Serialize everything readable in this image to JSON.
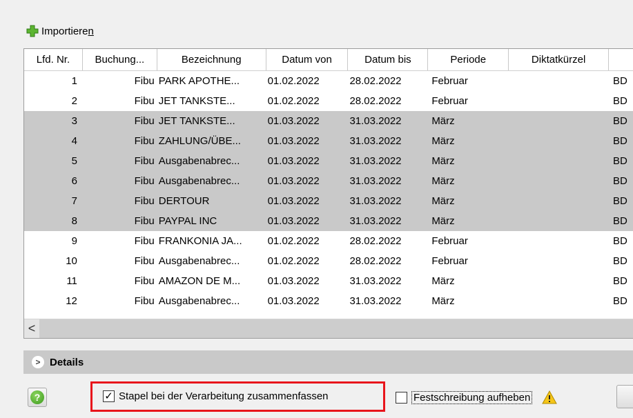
{
  "toolbar": {
    "import_label_main": "Importiere",
    "import_label_accel": "n"
  },
  "table": {
    "headers": [
      "Lfd. Nr.",
      "Buchung...",
      "Bezeichnung",
      "Datum von",
      "Datum bis",
      "Periode",
      "Diktatkürzel",
      ""
    ],
    "rows": [
      {
        "nr": "1",
        "buchung": "Fibu",
        "bez": "PARK APOTHE...",
        "von": "01.02.2022",
        "bis": "28.02.2022",
        "periode": "Februar",
        "diktat": "",
        "extra": "BD",
        "selected": false
      },
      {
        "nr": "2",
        "buchung": "Fibu",
        "bez": "JET TANKSTE...",
        "von": "01.02.2022",
        "bis": "28.02.2022",
        "periode": "Februar",
        "diktat": "",
        "extra": "BD",
        "selected": false
      },
      {
        "nr": "3",
        "buchung": "Fibu",
        "bez": "JET TANKSTE...",
        "von": "01.03.2022",
        "bis": "31.03.2022",
        "periode": "März",
        "diktat": "",
        "extra": "BD",
        "selected": true
      },
      {
        "nr": "4",
        "buchung": "Fibu",
        "bez": "ZAHLUNG/ÜBE...",
        "von": "01.03.2022",
        "bis": "31.03.2022",
        "periode": "März",
        "diktat": "",
        "extra": "BD",
        "selected": true
      },
      {
        "nr": "5",
        "buchung": "Fibu",
        "bez": "Ausgabenabrec...",
        "von": "01.03.2022",
        "bis": "31.03.2022",
        "periode": "März",
        "diktat": "",
        "extra": "BD",
        "selected": true
      },
      {
        "nr": "6",
        "buchung": "Fibu",
        "bez": "Ausgabenabrec...",
        "von": "01.03.2022",
        "bis": "31.03.2022",
        "periode": "März",
        "diktat": "",
        "extra": "BD",
        "selected": true
      },
      {
        "nr": "7",
        "buchung": "Fibu",
        "bez": "DERTOUR",
        "von": "01.03.2022",
        "bis": "31.03.2022",
        "periode": "März",
        "diktat": "",
        "extra": "BD",
        "selected": true
      },
      {
        "nr": "8",
        "buchung": "Fibu",
        "bez": "PAYPAL INC",
        "von": "01.03.2022",
        "bis": "31.03.2022",
        "periode": "März",
        "diktat": "",
        "extra": "BD",
        "selected": true
      },
      {
        "nr": "9",
        "buchung": "Fibu",
        "bez": "FRANKONIA JA...",
        "von": "01.02.2022",
        "bis": "28.02.2022",
        "periode": "Februar",
        "diktat": "",
        "extra": "BD",
        "selected": false
      },
      {
        "nr": "10",
        "buchung": "Fibu",
        "bez": "Ausgabenabrec...",
        "von": "01.02.2022",
        "bis": "28.02.2022",
        "periode": "Februar",
        "diktat": "",
        "extra": "BD",
        "selected": false
      },
      {
        "nr": "11",
        "buchung": "Fibu",
        "bez": "AMAZON DE M...",
        "von": "01.03.2022",
        "bis": "31.03.2022",
        "periode": "März",
        "diktat": "",
        "extra": "BD",
        "selected": false
      },
      {
        "nr": "12",
        "buchung": "Fibu",
        "bez": "Ausgabenabrec...",
        "von": "01.03.2022",
        "bis": "31.03.2022",
        "periode": "März",
        "diktat": "",
        "extra": "BD",
        "selected": false
      }
    ]
  },
  "scrollbar": {
    "left_arrow": "<"
  },
  "details": {
    "chevron": ">",
    "label": "Details"
  },
  "help": {
    "icon": "?"
  },
  "options": {
    "merge_batches": {
      "label": "Stapel bei der Verarbeitung zusammenfassen",
      "checked": true,
      "check_glyph": "✓"
    },
    "cancel_fixation": {
      "label": "Festschreibung aufheben",
      "checked": false
    }
  },
  "colors": {
    "selected_row": "#c9c9c9",
    "highlight_border": "#e8141b",
    "details_bar": "#c9c9c9"
  }
}
